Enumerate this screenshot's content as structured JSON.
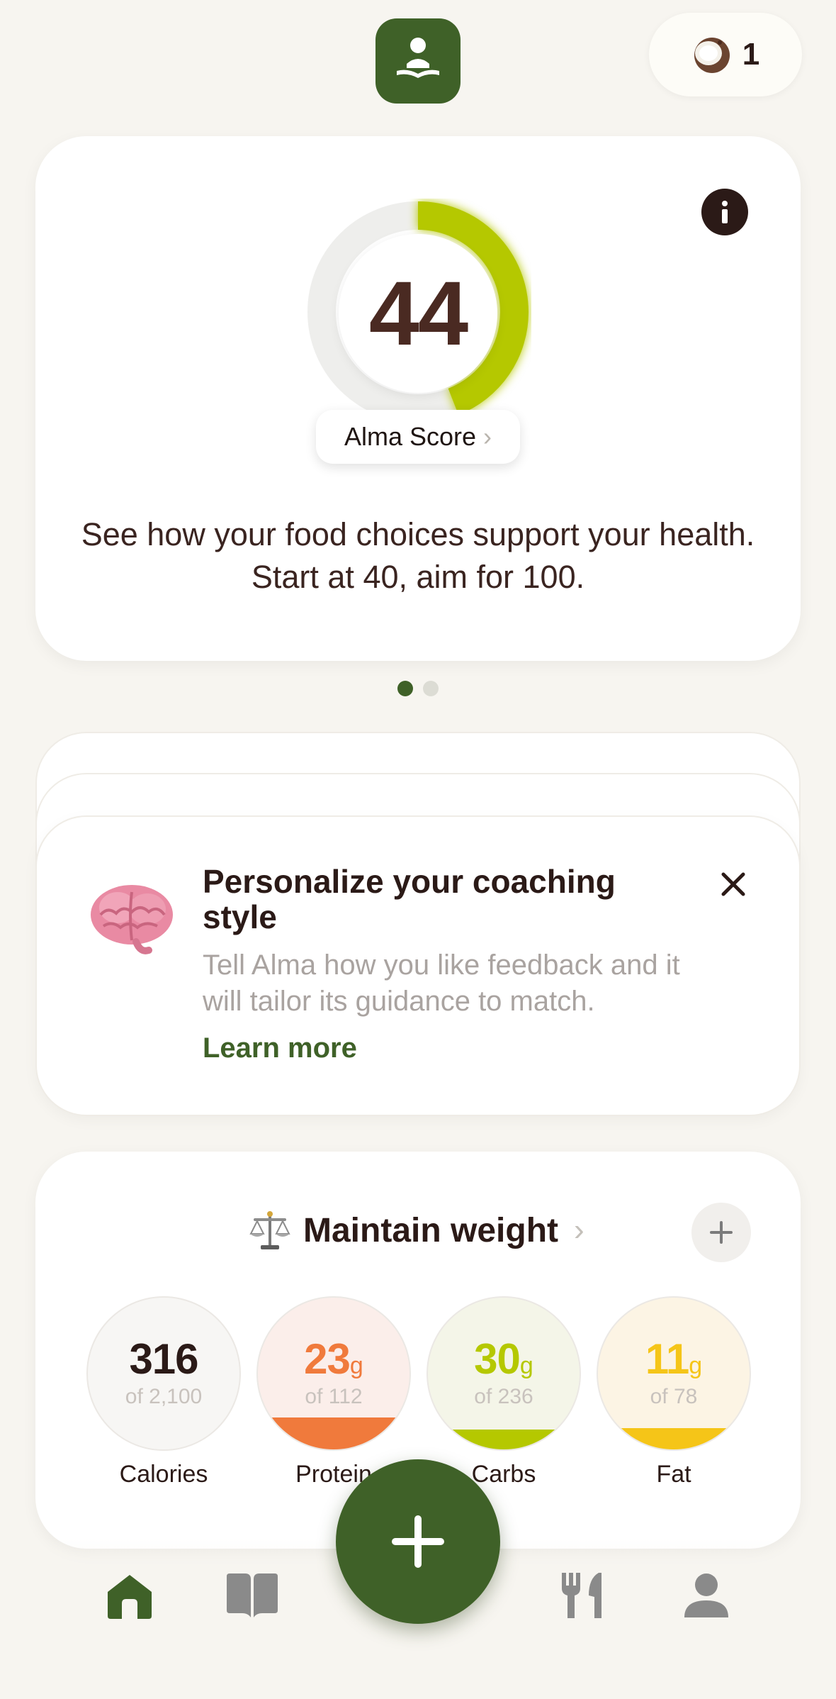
{
  "header": {
    "app_logo_icon": "reading-person-icon",
    "coins": {
      "icon": "coconut-icon",
      "count": "1"
    }
  },
  "score_card": {
    "score": "44",
    "score_progress": 0.44,
    "label": "Alma Score",
    "description": "See how your food choices support your health. Start at 40, aim for 100.",
    "info_icon": "info-icon",
    "colors": {
      "progress": "#b5c800",
      "track": "#eeeeee"
    }
  },
  "pager": {
    "total": 2,
    "active": 1
  },
  "coaching_card": {
    "icon": "brain-icon",
    "title": "Personalize your coaching style",
    "description": "Tell Alma how you like feedback and it will tailor its guidance to match.",
    "link": "Learn more",
    "close_icon": "close-icon"
  },
  "goal_card": {
    "goal_icon": "balance-scale-icon",
    "goal": "Maintain weight",
    "add_icon": "plus-icon",
    "macros": [
      {
        "value": "316",
        "unit": "",
        "of": "of 2,100",
        "label": "Calories",
        "progress": 0.15,
        "color": "#2b1a17",
        "bg": "#f7f6f4",
        "fill": "#f7f6f4"
      },
      {
        "value": "23",
        "unit": "g",
        "of": "of 112",
        "label": "Protein",
        "progress": 0.21,
        "color": "#f07a3c",
        "bg": "#fbeeea",
        "fill": "#f07a3c"
      },
      {
        "value": "30",
        "unit": "g",
        "of": "of 236",
        "label": "Carbs",
        "progress": 0.13,
        "color": "#b5c800",
        "bg": "#f4f5e8",
        "fill": "#b5c800"
      },
      {
        "value": "11",
        "unit": "g",
        "of": "of 78",
        "label": "Fat",
        "progress": 0.14,
        "color": "#f5c518",
        "bg": "#fcf4e4",
        "fill": "#f5c518"
      }
    ]
  },
  "bottom_nav": {
    "items": [
      "home-icon",
      "book-icon",
      "add-icon",
      "fork-knife-icon",
      "profile-icon"
    ],
    "active": "home-icon",
    "colors": {
      "active": "#3f6128",
      "inactive": "#8a8a8a",
      "fab": "#3f6128"
    }
  }
}
